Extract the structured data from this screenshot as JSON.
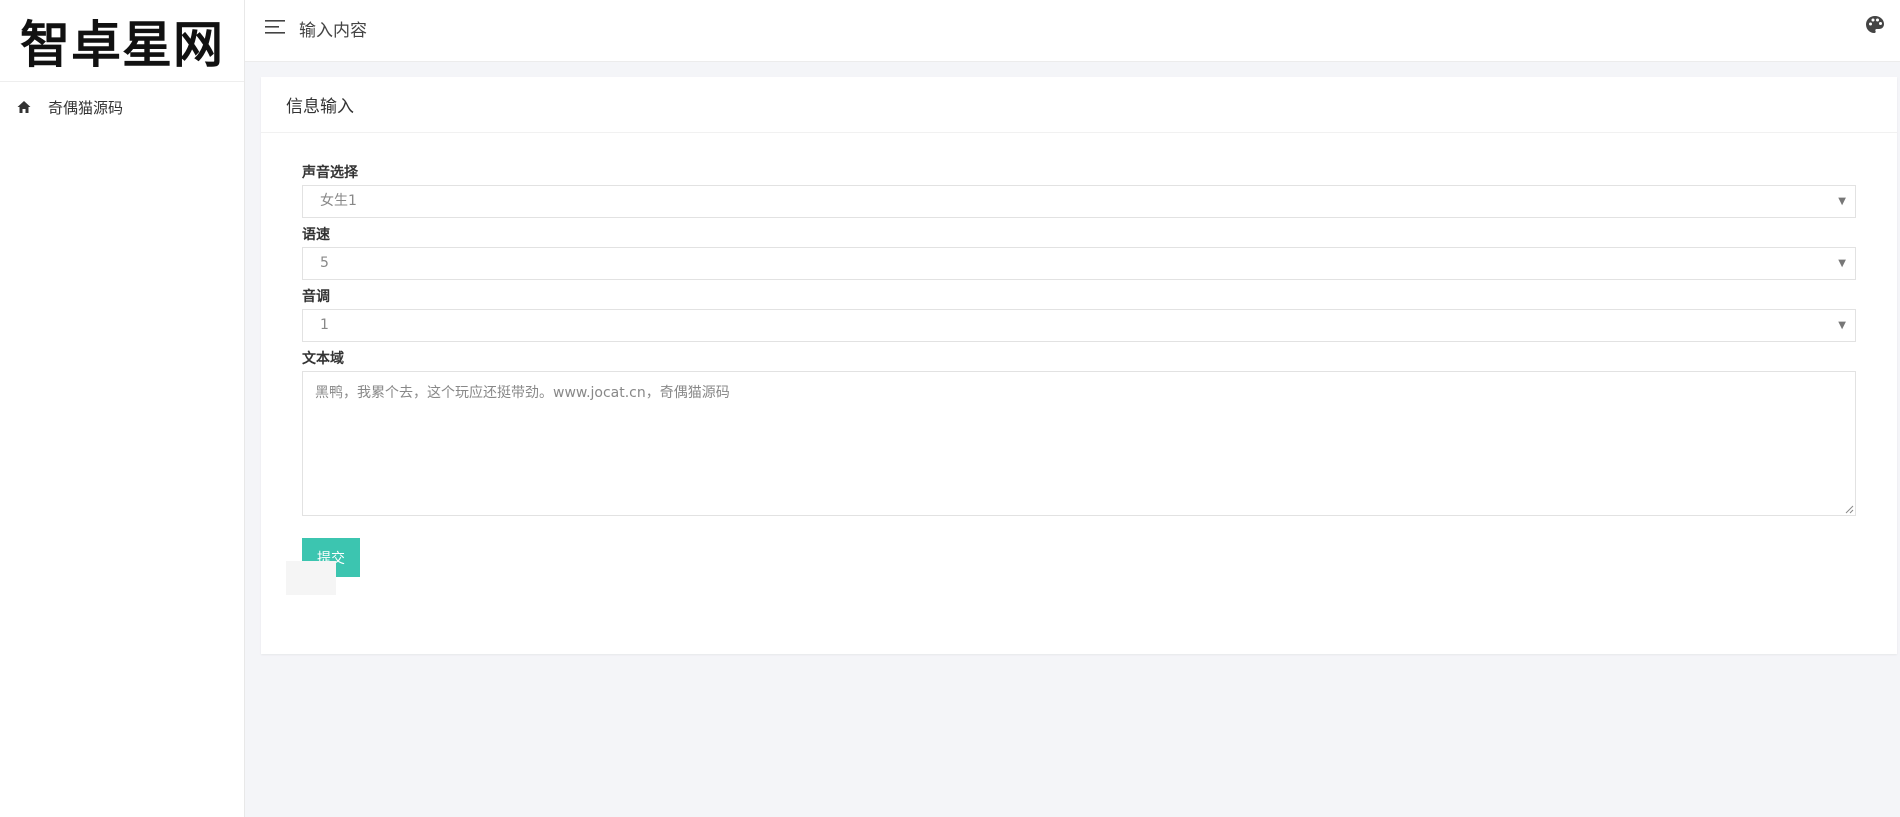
{
  "sidebar": {
    "logo": "智卓星网",
    "items": [
      {
        "label": "奇偶猫源码",
        "icon": "home-icon"
      }
    ]
  },
  "topbar": {
    "menu_icon": "menu-icon",
    "title": "输入内容",
    "theme_icon": "palette-icon"
  },
  "card": {
    "title": "信息输入",
    "form": {
      "voice_label": "声音选择",
      "voice_value": "女生1",
      "speed_label": "语速",
      "speed_value": "5",
      "pitch_label": "音调",
      "pitch_value": "1",
      "text_label": "文本域",
      "text_placeholder": "黑鸭，我累个去，这个玩应还挺带劲。www.jocat.cn，奇偶猫源码",
      "submit_label": "提交"
    }
  },
  "colors": {
    "accent": "#3cc5b0",
    "background": "#f4f5f8"
  }
}
